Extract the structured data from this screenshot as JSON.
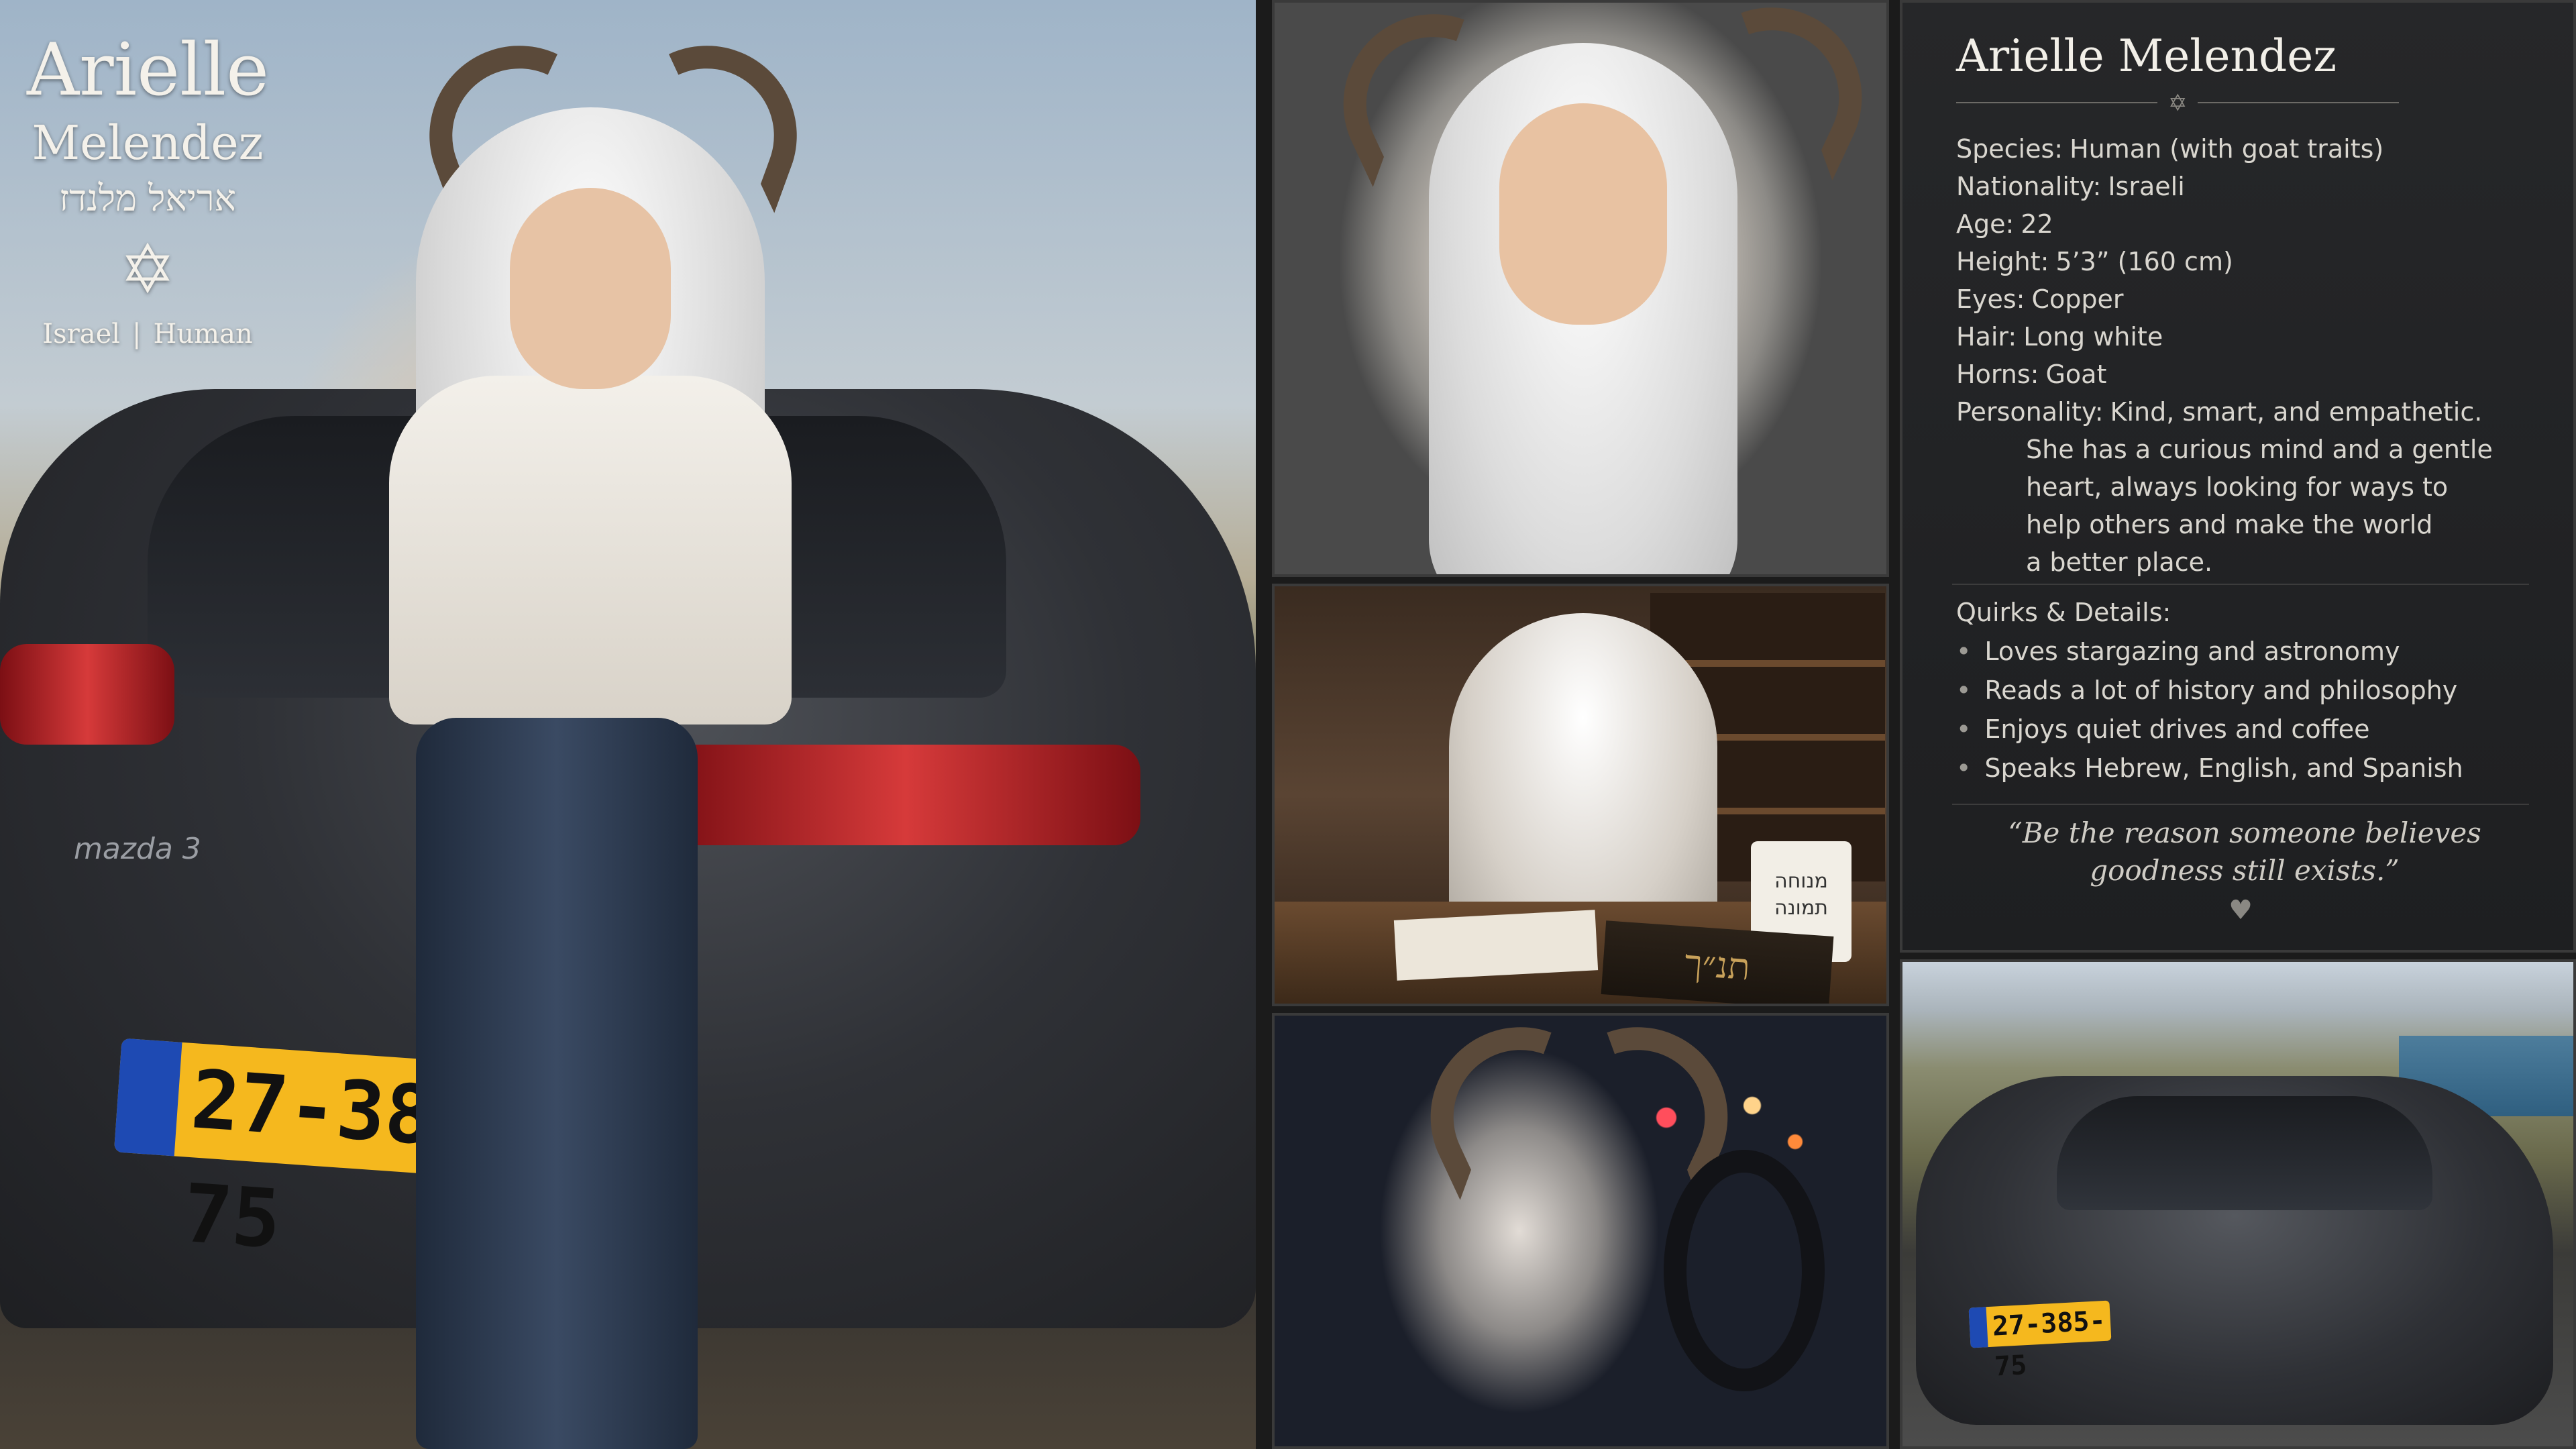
{
  "hero": {
    "first_name": "Arielle",
    "last_name": "Melendez",
    "hebrew_name": "אריאל מלנדז",
    "star_icon": "star-of-david-icon",
    "country": "Israel",
    "divider": "|",
    "species_short": "Human",
    "car_badge": "mazda 3",
    "plate": "27-385-75"
  },
  "profile": {
    "title": "Arielle Melendez",
    "details": [
      {
        "key": "Species:",
        "value": "Human (with goat traits)"
      },
      {
        "key": "Nationality:",
        "value": "Israeli"
      },
      {
        "key": "Age:",
        "value": "22"
      },
      {
        "key": "Height:",
        "value": "5’3” (160 cm)"
      },
      {
        "key": "Eyes:",
        "value": "Copper"
      },
      {
        "key": "Hair:",
        "value": "Long white"
      },
      {
        "key": "Horns:",
        "value": "Goat"
      }
    ],
    "personality_key": "Personality:",
    "personality_lines": [
      "Kind, smart, and empathetic.",
      "She has a curious mind and a gentle",
      "heart, always looking for ways to",
      "help others and make the world",
      "a better place."
    ],
    "quirks_title": "Quirks & Details:",
    "quirks": [
      "Loves stargazing and astronomy",
      "Reads a lot of history and philosophy",
      "Enjoys quiet drives and coffee",
      "Speaks Hebrew, English, and Spanish"
    ],
    "quote_lines": [
      "“Be the reason someone believes",
      "goodness still exists.”"
    ],
    "heart_icon": "heart-icon"
  },
  "scenes": {
    "mug_text": "מנוחה\nתמונה",
    "book_text": "תנ״ך",
    "plate2": "27-385-75"
  }
}
